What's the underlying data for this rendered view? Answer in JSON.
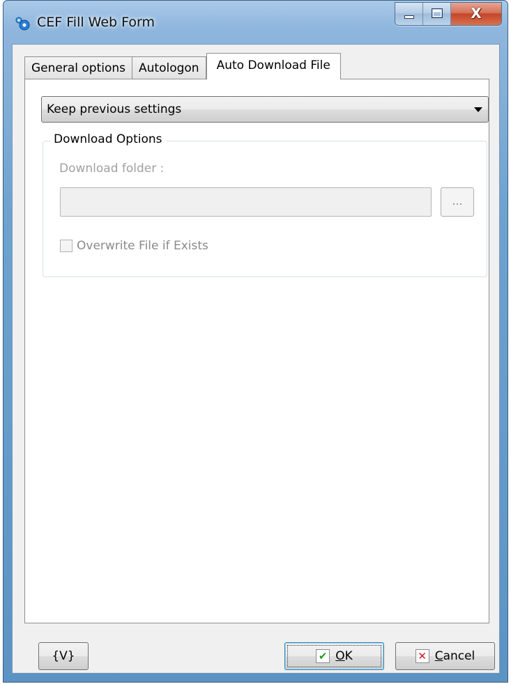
{
  "window": {
    "title": "CEF Fill Web Form",
    "app_icon": "gears-icon",
    "caption_buttons": {
      "minimize_icon": "minimize-icon",
      "maximize_icon": "maximize-icon",
      "close_glyph": "X"
    }
  },
  "tabs": [
    {
      "label": "General options",
      "active": false
    },
    {
      "label": "Autologon",
      "active": false
    },
    {
      "label": "Auto Download File",
      "active": true
    }
  ],
  "mode_select": {
    "selected": "Keep previous settings",
    "arrow_icon": "dropdown-arrow-icon"
  },
  "download_options": {
    "legend": "Download Options",
    "folder_label": "Download folder :",
    "folder_value": "",
    "browse_label": "...",
    "overwrite_label": "Overwrite File if Exists",
    "overwrite_checked": false,
    "enabled": false
  },
  "footer": {
    "variables_label": "{V}",
    "ok_mnemonic": "O",
    "ok_rest": "K",
    "ok_icon": "checkmark-icon",
    "cancel_mnemonic": "C",
    "cancel_rest": "ancel",
    "cancel_icon": "cross-icon"
  },
  "colors": {
    "title_bar": "#8fb6dd",
    "close_button": "#c4452a",
    "ok_icon": "#1e9a1e",
    "cancel_icon": "#d21a1a",
    "disabled_text": "#a0a0a0"
  }
}
